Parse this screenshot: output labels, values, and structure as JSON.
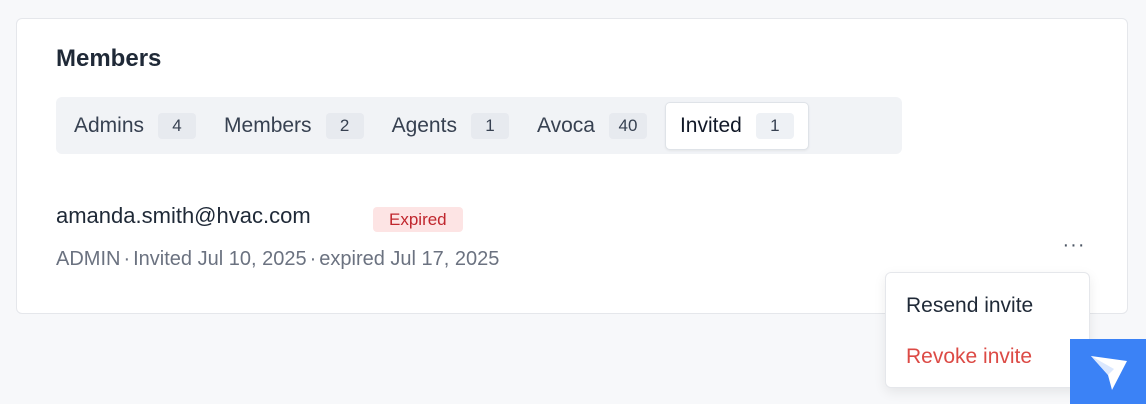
{
  "section": {
    "title": "Members"
  },
  "tabs": [
    {
      "label": "Admins",
      "count": "4",
      "active": false
    },
    {
      "label": "Members",
      "count": "2",
      "active": false
    },
    {
      "label": "Agents",
      "count": "1",
      "active": false
    },
    {
      "label": "Avoca",
      "count": "40",
      "active": false
    },
    {
      "label": "Invited",
      "count": "1",
      "active": true
    }
  ],
  "invite": {
    "email": "amanda.smith@hvac.com",
    "status": "Expired",
    "role": "ADMIN",
    "separator": "·",
    "invited": "Invited Jul 10, 2025",
    "expired": "expired Jul 17, 2025",
    "more": "···"
  },
  "menu": {
    "resend": "Resend invite",
    "revoke": "Revoke invite"
  },
  "colors": {
    "accent": "#3b82f6",
    "danger": "#dc4a45",
    "badge_bg": "#fde4e4",
    "badge_text": "#c0262d"
  },
  "icons": {
    "fab": "send-arrow-icon"
  }
}
